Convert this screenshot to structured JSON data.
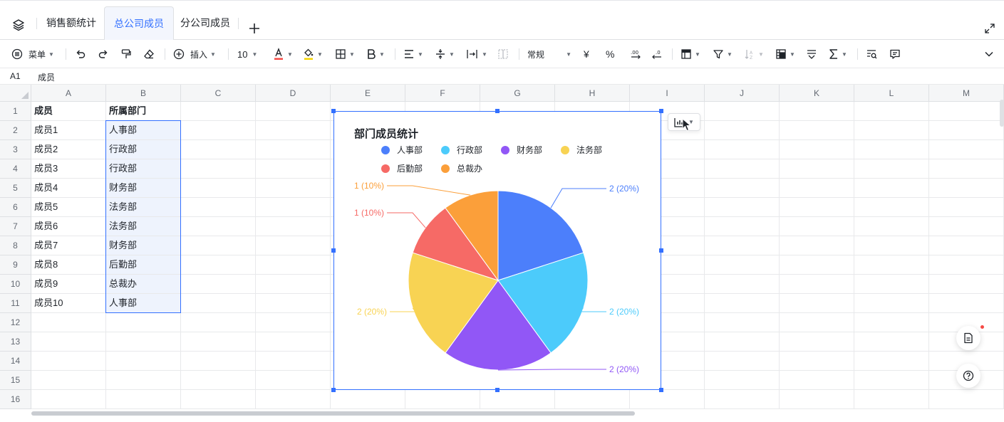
{
  "tabs": [
    {
      "label": "销售额统计",
      "active": false
    },
    {
      "label": "总公司成员",
      "active": true
    },
    {
      "label": "分公司成员",
      "active": false
    }
  ],
  "toolbar": {
    "menu_label": "菜单",
    "insert_label": "插入",
    "font_size": "10",
    "number_format": "常规",
    "currency_symbol": "¥",
    "percent_symbol": "%"
  },
  "formula_bar": {
    "cell_ref": "A1",
    "value": "成员"
  },
  "columns": [
    "A",
    "B",
    "C",
    "D",
    "E",
    "F",
    "G",
    "H",
    "I",
    "J",
    "K",
    "L",
    "M"
  ],
  "rows": [
    "1",
    "2",
    "3",
    "4",
    "5",
    "6",
    "7",
    "8",
    "9",
    "10",
    "11",
    "12",
    "13",
    "14",
    "15",
    "16"
  ],
  "sheet": {
    "headers": [
      "成员",
      "所属部门"
    ],
    "data": [
      [
        "成员1",
        "人事部"
      ],
      [
        "成员2",
        "行政部"
      ],
      [
        "成员3",
        "行政部"
      ],
      [
        "成员4",
        "财务部"
      ],
      [
        "成员5",
        "法务部"
      ],
      [
        "成员6",
        "法务部"
      ],
      [
        "成员7",
        "财务部"
      ],
      [
        "成员8",
        "后勤部"
      ],
      [
        "成员9",
        "总裁办"
      ],
      [
        "成员10",
        "人事部"
      ]
    ]
  },
  "chart_data": {
    "type": "pie",
    "title": "部门成员统计",
    "legend_position": "top",
    "slices": [
      {
        "name": "人事部",
        "value": 2,
        "percent": 20,
        "color": "#4c7ffb",
        "label": "2 (20%)"
      },
      {
        "name": "行政部",
        "value": 2,
        "percent": 20,
        "color": "#4ccbfb",
        "label": "2 (20%)"
      },
      {
        "name": "财务部",
        "value": 2,
        "percent": 20,
        "color": "#9157f6",
        "label": "2 (20%)"
      },
      {
        "name": "法务部",
        "value": 2,
        "percent": 20,
        "color": "#f8d353",
        "label": "2 (20%)"
      },
      {
        "name": "后勤部",
        "value": 1,
        "percent": 10,
        "color": "#f66a66",
        "label": "1 (10%)"
      },
      {
        "name": "总裁办",
        "value": 1,
        "percent": 10,
        "color": "#fb9f3a",
        "label": "1 (10%)"
      }
    ]
  },
  "colors": {
    "accent": "#3370ff",
    "selection_fill": "#eef3fd",
    "notification": "#f54a45"
  }
}
